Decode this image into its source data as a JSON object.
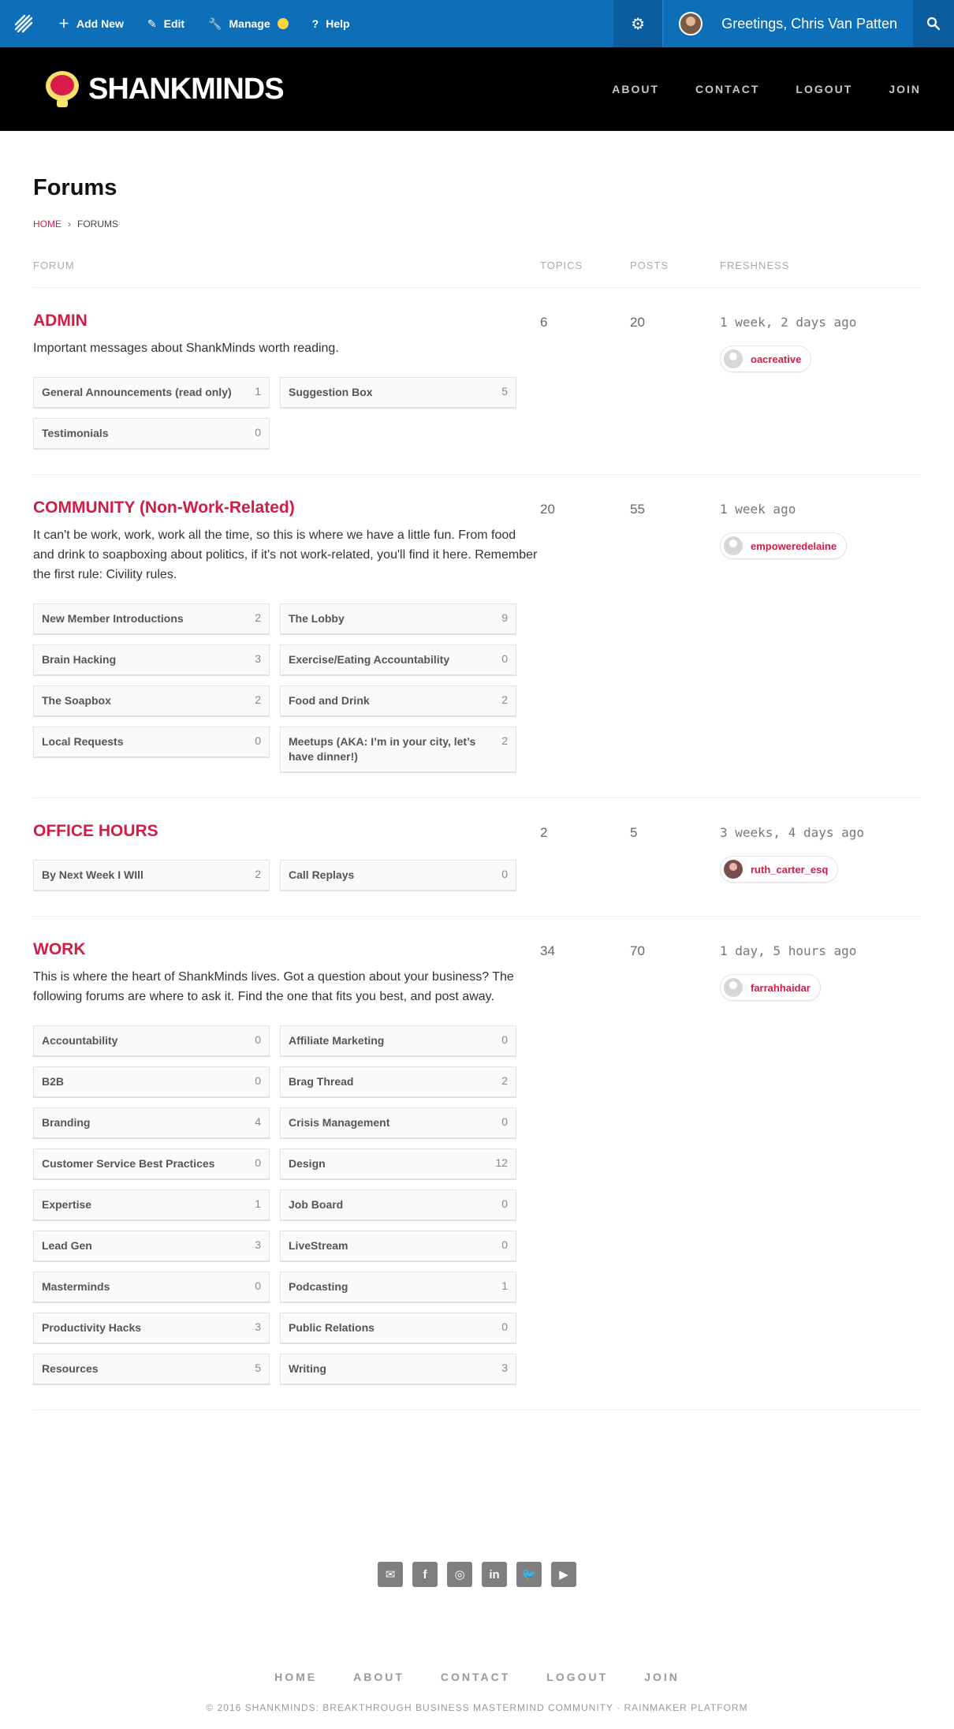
{
  "admin_bar": {
    "add_new": "Add New",
    "edit": "Edit",
    "manage": "Manage",
    "help": "Help",
    "greeting": "Greetings, Chris Van Patten"
  },
  "site": {
    "brand": "SHANKMINDS",
    "nav": [
      "ABOUT",
      "CONTACT",
      "LOGOUT",
      "JOIN"
    ]
  },
  "page": {
    "title": "Forums",
    "breadcrumb": {
      "home": "HOME",
      "sep": "›",
      "current": "FORUMS"
    }
  },
  "table_headers": {
    "forum": "FORUM",
    "topics": "TOPICS",
    "posts": "POSTS",
    "freshness": "FRESHNESS"
  },
  "forums": [
    {
      "title": "ADMIN",
      "description": "Important messages about ShankMinds worth reading.",
      "topics": "6",
      "posts": "20",
      "freshness": "1 week, 2 days ago",
      "user": "oacreative",
      "subforums": [
        {
          "name": "General Announcements (read only)",
          "count": "1"
        },
        {
          "name": "Suggestion Box",
          "count": "5"
        },
        {
          "name": "Testimonials",
          "count": "0"
        }
      ]
    },
    {
      "title": "COMMUNITY (Non-Work-Related)",
      "description": "It can't be work, work, work all the time, so this is where we have a little fun. From food and drink to soapboxing about politics, if it's not work-related, you'll find it here. Remember the first rule: Civility rules.",
      "topics": "20",
      "posts": "55",
      "freshness": "1 week ago",
      "user": "empoweredelaine",
      "subforums": [
        {
          "name": "New Member Introductions",
          "count": "2"
        },
        {
          "name": "The Lobby",
          "count": "9"
        },
        {
          "name": "Brain Hacking",
          "count": "3"
        },
        {
          "name": "Exercise/Eating Accountability",
          "count": "0"
        },
        {
          "name": "The Soapbox",
          "count": "2"
        },
        {
          "name": "Food and Drink",
          "count": "2"
        },
        {
          "name": "Local Requests",
          "count": "0"
        },
        {
          "name": "Meetups (AKA: I’m in your city, let’s have dinner!)",
          "count": "2"
        }
      ]
    },
    {
      "title": "OFFICE HOURS",
      "description": "",
      "topics": "2",
      "posts": "5",
      "freshness": "3 weeks, 4 days ago",
      "user": "ruth_carter_esq",
      "subforums": [
        {
          "name": "By Next Week I WIll",
          "count": "2"
        },
        {
          "name": "Call Replays",
          "count": "0"
        }
      ]
    },
    {
      "title": "WORK",
      "description": "This is where the heart of ShankMinds lives. Got a question about your business? The following forums are where to ask it. Find the one that fits you best, and post away.",
      "topics": "34",
      "posts": "70",
      "freshness": "1 day, 5 hours ago",
      "user": "farrahhaidar",
      "subforums": [
        {
          "name": "Accountability",
          "count": "0"
        },
        {
          "name": "Affiliate Marketing",
          "count": "0"
        },
        {
          "name": "B2B",
          "count": "0"
        },
        {
          "name": "Brag Thread",
          "count": "2"
        },
        {
          "name": "Branding",
          "count": "4"
        },
        {
          "name": "Crisis Management",
          "count": "0"
        },
        {
          "name": "Customer Service Best Practices",
          "count": "0"
        },
        {
          "name": "Design",
          "count": "12"
        },
        {
          "name": "Expertise",
          "count": "1"
        },
        {
          "name": "Job Board",
          "count": "0"
        },
        {
          "name": "Lead Gen",
          "count": "3"
        },
        {
          "name": "LiveStream",
          "count": "0"
        },
        {
          "name": "Masterminds",
          "count": "0"
        },
        {
          "name": "Podcasting",
          "count": "1"
        },
        {
          "name": "Productivity Hacks",
          "count": "3"
        },
        {
          "name": "Public Relations",
          "count": "0"
        },
        {
          "name": "Resources",
          "count": "5"
        },
        {
          "name": "Writing",
          "count": "3"
        }
      ]
    }
  ],
  "footer": {
    "social_icons": [
      "email-icon",
      "facebook-icon",
      "instagram-icon",
      "linkedin-icon",
      "twitter-icon",
      "youtube-icon"
    ],
    "nav": [
      "HOME",
      "ABOUT",
      "CONTACT",
      "LOGOUT",
      "JOIN"
    ],
    "copyright": "© 2016 SHANKMINDS: BREAKTHROUGH BUSINESS MASTERMIND COMMUNITY · RAINMAKER PLATFORM"
  },
  "colors": {
    "admin_bar": "#0c6fb8",
    "accent": "#d11c45",
    "header": "#000000"
  }
}
